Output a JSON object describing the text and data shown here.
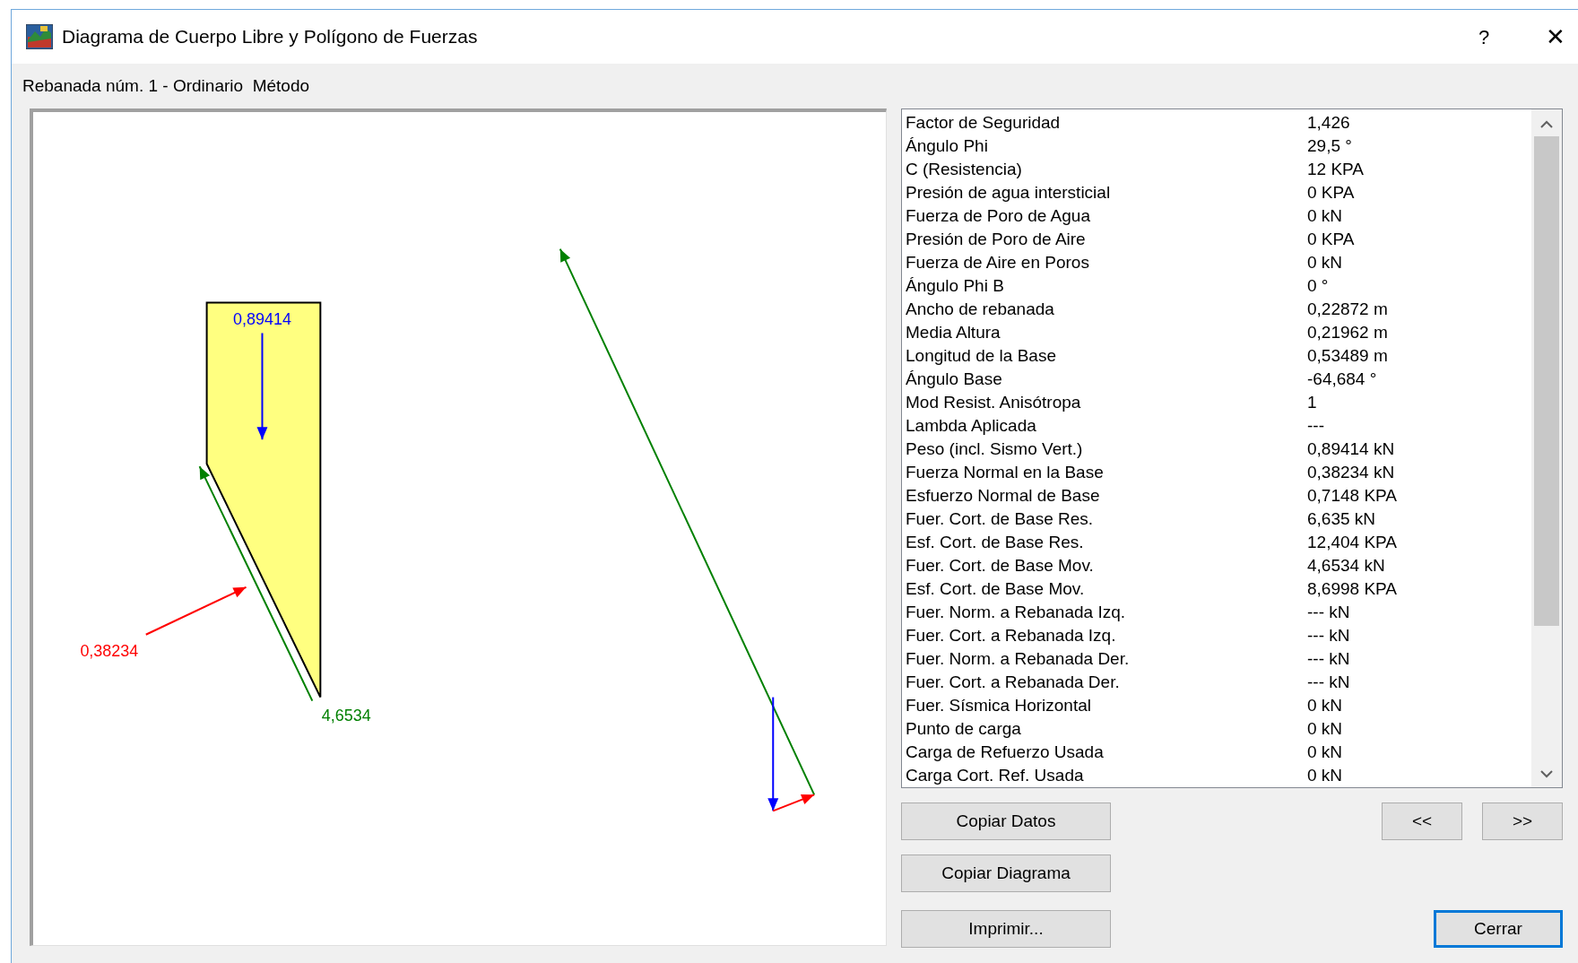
{
  "window": {
    "title": "Diagrama de Cuerpo Libre y Polígono de Fuerzas",
    "help": "?",
    "close": "✕"
  },
  "subtitle": "Rebanada núm. 1 - Ordinario  Método",
  "diagram": {
    "weight_label": "0,89414",
    "normal_label": "0,38234",
    "shear_label": "4,6534"
  },
  "table": {
    "rows": [
      {
        "name": "Factor de Seguridad",
        "value": "1,426"
      },
      {
        "name": "Ángulo Phi",
        "value": "29,5 °"
      },
      {
        "name": "C (Resistencia)",
        "value": "12 KPA"
      },
      {
        "name": "Presión de agua intersticial",
        "value": "0 KPA"
      },
      {
        "name": "Fuerza de Poro de Agua",
        "value": "0 kN"
      },
      {
        "name": "Presión de Poro de Aire",
        "value": "0 KPA"
      },
      {
        "name": "Fuerza de Aire en Poros",
        "value": "0 kN"
      },
      {
        "name": "Ángulo Phi B",
        "value": "0 °"
      },
      {
        "name": "Ancho de rebanada",
        "value": "0,22872 m"
      },
      {
        "name": "Media Altura",
        "value": "0,21962 m"
      },
      {
        "name": "Longitud de la Base",
        "value": "0,53489 m"
      },
      {
        "name": "Ángulo Base",
        "value": "-64,684 °"
      },
      {
        "name": "Mod Resist. Anisótropa",
        "value": "1"
      },
      {
        "name": "Lambda Aplicada",
        "value": "---"
      },
      {
        "name": "Peso (incl. Sismo Vert.)",
        "value": "0,89414 kN"
      },
      {
        "name": "Fuerza Normal en la Base",
        "value": "0,38234 kN"
      },
      {
        "name": "Esfuerzo Normal de Base",
        "value": "0,7148 KPA"
      },
      {
        "name": "Fuer. Cort. de Base Res.",
        "value": "6,635 kN"
      },
      {
        "name": "Esf. Cort. de Base Res.",
        "value": "12,404 KPA"
      },
      {
        "name": "Fuer. Cort. de Base Mov.",
        "value": "4,6534 kN"
      },
      {
        "name": "Esf. Cort. de Base Mov.",
        "value": "8,6998 KPA"
      },
      {
        "name": "Fuer. Norm. a Rebanada Izq.",
        "value": "--- kN"
      },
      {
        "name": "Fuer. Cort. a Rebanada Izq.",
        "value": "--- kN"
      },
      {
        "name": "Fuer. Norm. a Rebanada Der.",
        "value": "--- kN"
      },
      {
        "name": "Fuer. Cort. a Rebanada Der.",
        "value": "--- kN"
      },
      {
        "name": "Fuer. Sísmica Horizontal",
        "value": "0 kN"
      },
      {
        "name": "Punto de carga",
        "value": "0 kN"
      },
      {
        "name": "Carga de Refuerzo Usada",
        "value": "0 kN"
      },
      {
        "name": "Carga Cort. Ref. Usada",
        "value": "0 kN"
      }
    ]
  },
  "buttons": {
    "copy_data": {
      "label": "Copiar Datos",
      "default": false
    },
    "copy_diagram": {
      "label": "Copiar Diagrama",
      "default": false
    },
    "print": {
      "label": "Imprimir...",
      "default": false
    },
    "prev": {
      "label": "<<",
      "default": false
    },
    "next": {
      "label": ">>",
      "default": false
    },
    "close": {
      "label": "Cerrar",
      "default": true
    }
  }
}
